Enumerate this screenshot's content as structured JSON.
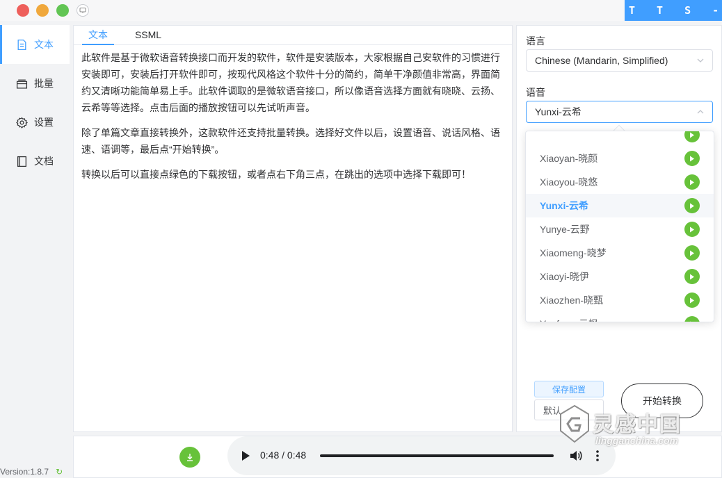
{
  "window": {
    "brand": "T T S - V U E"
  },
  "sidebar": {
    "items": [
      {
        "label": "文本",
        "icon": "document-icon",
        "active": true
      },
      {
        "label": "批量",
        "icon": "batch-icon",
        "active": false
      },
      {
        "label": "设置",
        "icon": "gear-icon",
        "active": false
      },
      {
        "label": "文档",
        "icon": "book-icon",
        "active": false
      }
    ],
    "version": "Version:1.8.7"
  },
  "editor": {
    "tabs": [
      "文本",
      "SSML"
    ],
    "paragraphs": [
      "此软件是基于微软语音转换接口而开发的软件，软件是安装版本，大家根据自己安软件的习惯进行安装即可，安装后打开软件即可，按现代风格这个软件十分的简约，简单干净颜值非常高，界面简约又清晰功能简单易上手。此软件调取的是微软语音接口，所以像语音选择方面就有晓晓、云扬、云希等等选择。点击后面的播放按钮可以先试听声音。",
      "除了单篇文章直接转换外，这款软件还支持批量转换。选择好文件以后，设置语音、说话风格、语速、语调等，最后点“开始转换”。",
      "转换以后可以直接点绿色的下载按钮，或者点右下角三点，在跳出的选项中选择下载即可！"
    ]
  },
  "config": {
    "language_label": "语言",
    "language_value": "Chinese (Mandarin, Simplified)",
    "voice_label": "语音",
    "voice_value": "Yunxi-云希",
    "voice_options": [
      {
        "label": "Xiaoyan-晓颜",
        "selected": false
      },
      {
        "label": "Xiaoyou-晓悠",
        "selected": false
      },
      {
        "label": "Yunxi-云希",
        "selected": true
      },
      {
        "label": "Yunye-云野",
        "selected": false
      },
      {
        "label": "Xiaomeng-晓梦",
        "selected": false
      },
      {
        "label": "Xiaoyi-晓伊",
        "selected": false
      },
      {
        "label": "Xiaozhen-晓甄",
        "selected": false
      },
      {
        "label": "Yunfeng-云枫",
        "selected": false
      }
    ],
    "save_button": "保存配置",
    "default_button": "默认",
    "start_button": "开始转换"
  },
  "player": {
    "time": "0:48 / 0:48",
    "progress": 1.0
  },
  "watermark": {
    "cn": "灵感中国",
    "url": "lingganchina.com"
  },
  "colors": {
    "accent": "#409eff",
    "play_green": "#67c23a"
  }
}
